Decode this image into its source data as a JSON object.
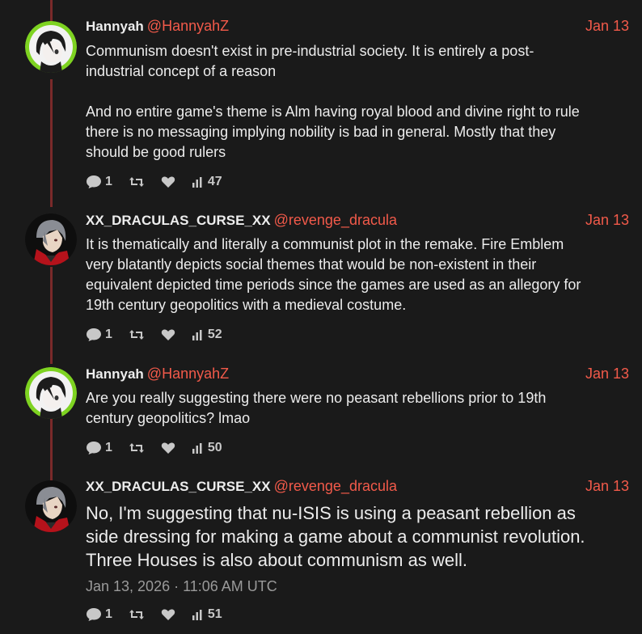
{
  "tweets": [
    {
      "name": "Hannyah",
      "handle": "@HannyahZ",
      "date": "Jan 13",
      "text": "Communism doesn't exist in pre-industrial society. It is entirely a post-\nindustrial concept of a reason\n\nAnd no entire game's theme is Alm having royal blood and divine right to rule\nthere is no messaging implying nobility is bad in general. Mostly that they\nshould be good rulers",
      "replies": "1",
      "views": "47",
      "avatar": "hannyah-avatar"
    },
    {
      "name": "XX_DRACULAS_CURSE_XX",
      "handle": "@revenge_dracula",
      "date": "Jan 13",
      "text": "It is thematically and literally a communist plot in the remake. Fire Emblem\nvery blatantly depicts social themes that would be non-existent in their\nequivalent depicted time periods since the games are used as an allegory for\n19th century geopolitics with a medieval costume.",
      "replies": "1",
      "views": "52",
      "avatar": "dracula-avatar"
    },
    {
      "name": "Hannyah",
      "handle": "@HannyahZ",
      "date": "Jan 13",
      "text": "Are you really suggesting there were no peasant rebellions prior to 19th\ncentury geopolitics? lmao",
      "replies": "1",
      "views": "50",
      "avatar": "hannyah-avatar"
    },
    {
      "name": "XX_DRACULAS_CURSE_XX",
      "handle": "@revenge_dracula",
      "date": "Jan 13",
      "text": "No, I'm suggesting that nu-ISIS is using a peasant rebellion as\nside dressing for making a game about a communist revolution.\nThree Houses is also about communism as well.",
      "timestamp": "Jan 13, 2026 · 11:06 AM UTC",
      "replies": "1",
      "views": "51",
      "avatar": "dracula-avatar"
    }
  ],
  "colors": {
    "accent": "#f25a4a",
    "thread_line": "#7a2a2a",
    "background": "#1a1a1a"
  },
  "icons": [
    "reply-icon",
    "retweet-icon",
    "heart-icon",
    "views-icon"
  ]
}
